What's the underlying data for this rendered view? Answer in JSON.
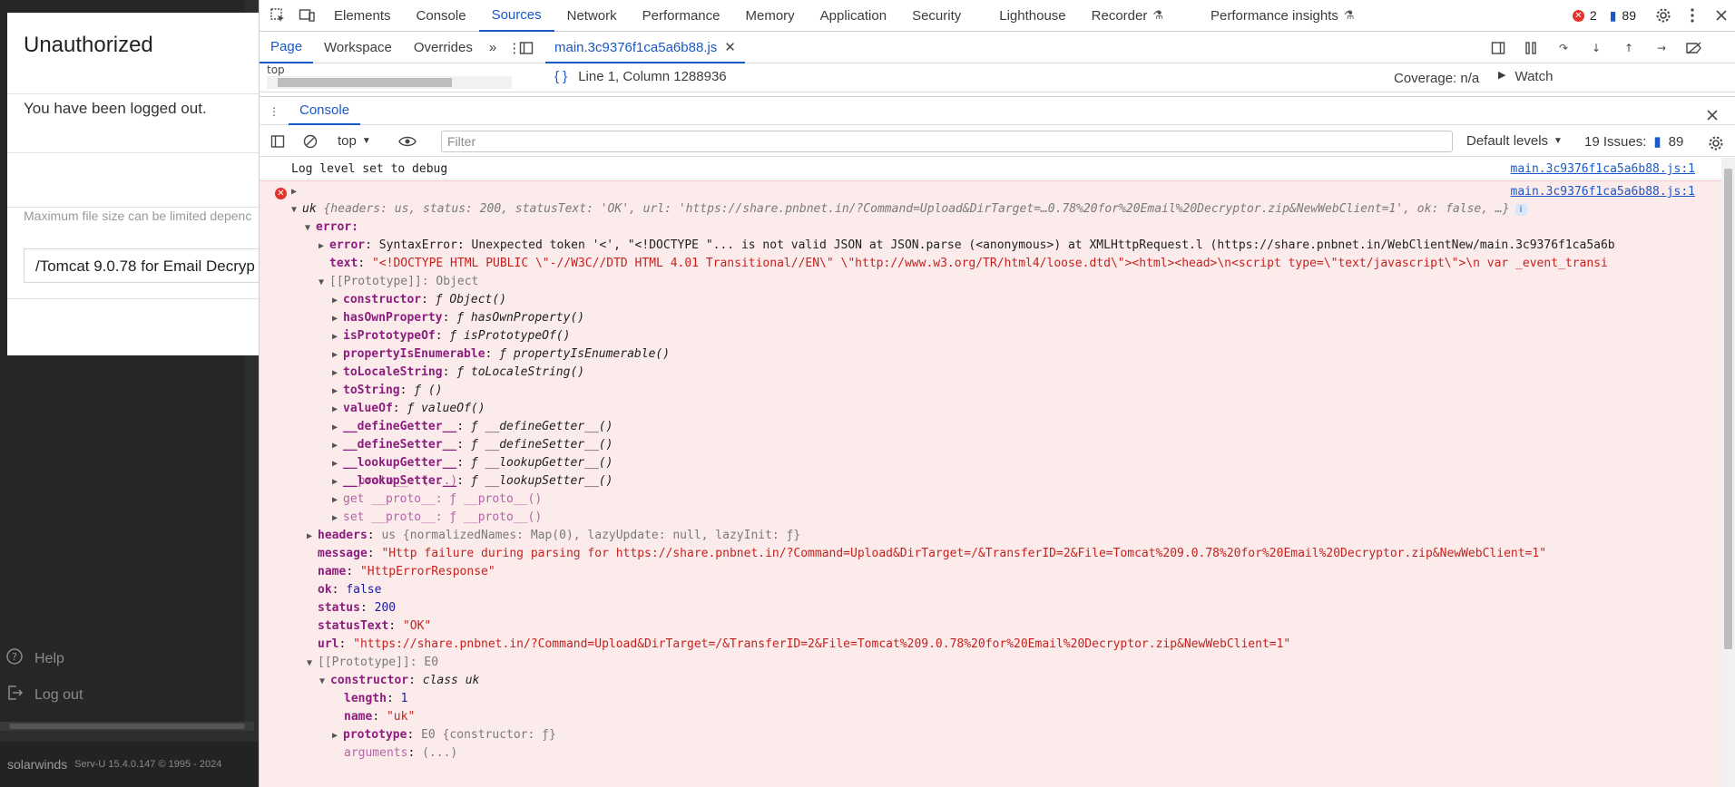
{
  "app": {
    "modal": {
      "title": "Unauthorized",
      "body": "You have been logged out.",
      "hint": "Maximum file size can be limited depenc",
      "field_value": "/Tomcat 9.0.78 for Email Decryp"
    },
    "nav": {
      "help": "Help",
      "logout": "Log out"
    },
    "footer": {
      "brand": "solarwinds",
      "version": "Serv-U 15.4.0.147 © 1995 - 2024"
    }
  },
  "devtools": {
    "main_tabs": [
      "Elements",
      "Console",
      "Sources",
      "Network",
      "Performance",
      "Memory",
      "Application",
      "Security",
      "Lighthouse",
      "Recorder",
      "Performance insights"
    ],
    "active_tab": "Sources",
    "error_count": "2",
    "message_count": "89",
    "sources_subtabs": [
      "Page",
      "Workspace",
      "Overrides"
    ],
    "file_tab": "main.3c9376f1ca5a6b88.js",
    "tree_top": "top",
    "cursor_pos": "Line 1, Column 1288936",
    "coverage": "Coverage: n/a",
    "watch": "Watch",
    "drawer_tab": "Console",
    "context": "top",
    "filter_placeholder": "Filter",
    "levels": "Default levels",
    "issues_label": "19 Issues:",
    "issues_count": "89",
    "colors": {
      "accent": "#1a58c7",
      "error_bg": "#fcebeb",
      "error_red": "#e0352a"
    }
  },
  "console": {
    "info_text": "Log level set to debug",
    "src": "main.3c9376f1ca5a6b88.js:1",
    "err_summary": {
      "name": "uk",
      "preview": "{headers: us, status: 200, statusText: 'OK', url: 'https://share.pnbnet.in/?Command=Upload&DirTarget=…0.78%20for%20Email%20Decryptor.zip&NewWebClient=1', ok: false, …}"
    },
    "error_label": "error:",
    "error_error": "SyntaxError: Unexpected token '<', \"<!DOCTYPE \"... is not valid JSON at JSON.parse (<anonymous>) at XMLHttpRequest.l (https://share.pnbnet.in/WebClientNew/main.3c9376f1ca5a6b",
    "error_text": "\"<!DOCTYPE HTML PUBLIC \\\"-//W3C//DTD HTML 4.01 Transitional//EN\\\" \\\"http://www.w3.org/TR/html4/loose.dtd\\\"><html><head>\\n<script type=\\\"text/javascript\\\">\\n  var _event_transi",
    "proto_obj": "[[Prototype]]: Object",
    "proto_items": [
      {
        "key": "constructor",
        "val": "ƒ Object()"
      },
      {
        "key": "hasOwnProperty",
        "val": "ƒ hasOwnProperty()"
      },
      {
        "key": "isPrototypeOf",
        "val": "ƒ isPrototypeOf()"
      },
      {
        "key": "propertyIsEnumerable",
        "val": "ƒ propertyIsEnumerable()"
      },
      {
        "key": "toLocaleString",
        "val": "ƒ toLocaleString()"
      },
      {
        "key": "toString",
        "val": "ƒ ()"
      },
      {
        "key": "valueOf",
        "val": "ƒ valueOf()"
      },
      {
        "key": "__defineGetter__",
        "val": "ƒ __defineGetter__()"
      },
      {
        "key": "__defineSetter__",
        "val": "ƒ __defineSetter__()"
      },
      {
        "key": "__lookupGetter__",
        "val": "ƒ __lookupGetter__()"
      },
      {
        "key": "__lookupSetter__",
        "val": "ƒ __lookupSetter__()"
      }
    ],
    "proto_proto": "__proto__: (...)",
    "get_proto": "get __proto__: ƒ __proto__()",
    "set_proto": "set __proto__: ƒ __proto__()",
    "headers": "us {normalizedNames: Map(0), lazyUpdate: null, lazyInit: ƒ}",
    "message": "\"Http failure during parsing for https://share.pnbnet.in/?Command=Upload&DirTarget=/&TransferID=2&File=Tomcat%209.0.78%20for%20Email%20Decryptor.zip&NewWebClient=1\"",
    "name": "\"HttpErrorResponse\"",
    "ok": "false",
    "status": "200",
    "statusText": "\"OK\"",
    "url": "\"https://share.pnbnet.in/?Command=Upload&DirTarget=/&TransferID=2&File=Tomcat%209.0.78%20for%20Email%20Decryptor.zip&NewWebClient=1\"",
    "proto_e0": "[[Prototype]]: E0",
    "ctor": "class uk",
    "length": "1",
    "name2": "\"uk\"",
    "prototype": "E0 {constructor: ƒ}",
    "arguments": "(...)"
  }
}
